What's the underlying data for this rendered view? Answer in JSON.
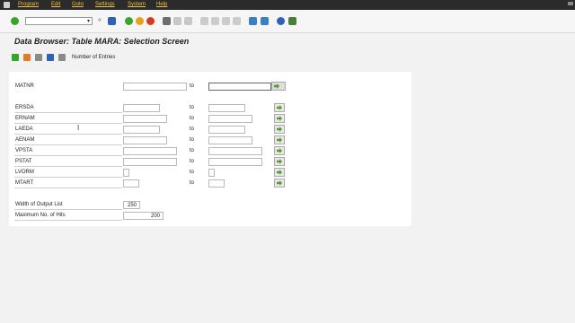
{
  "menu": [
    "Program",
    "Edit",
    "Goto",
    "Settings",
    "System",
    "Help"
  ],
  "header": {
    "title": "Data Browser: Table MARA: Selection Screen"
  },
  "app_toolbar": {
    "number_of_entries": "Number of Entries"
  },
  "selection": {
    "to_label": "to",
    "fields": [
      {
        "name": "MATNR",
        "from": "",
        "to": ""
      },
      {
        "name": "ERSDA",
        "from": "",
        "to": ""
      },
      {
        "name": "ERNAM",
        "from": "",
        "to": ""
      },
      {
        "name": "LAEDA",
        "from": "",
        "to": ""
      },
      {
        "name": "AENAM",
        "from": "",
        "to": ""
      },
      {
        "name": "VPSTA",
        "from": "",
        "to": ""
      },
      {
        "name": "PSTAT",
        "from": "",
        "to": ""
      },
      {
        "name": "LVORM",
        "from": "",
        "to": ""
      },
      {
        "name": "MTART",
        "from": "",
        "to": ""
      }
    ],
    "width_of_output_list": {
      "label": "Width of Output List",
      "value": "250"
    },
    "max_hits": {
      "label": "Maximum No. of Hits",
      "value": "200"
    }
  },
  "icons": [
    "enter-icon",
    "save-icon",
    "back-icon",
    "exit-icon",
    "cancel-icon",
    "print-icon",
    "find-icon",
    "find-next-icon",
    "first-page-icon",
    "prev-page-icon",
    "next-page-icon",
    "last-page-icon",
    "new-session-icon",
    "shortcut-icon",
    "help-icon",
    "customize-icon",
    "execute-icon",
    "selection-options-icon",
    "program-icon",
    "info-icon",
    "choose-fields-icon",
    "multiple-selection-icon"
  ],
  "colors": {
    "menubar": "#2b2b2b",
    "menu_text": "#f0c040",
    "panel": "#ffffff",
    "background": "#f2f2f2"
  }
}
